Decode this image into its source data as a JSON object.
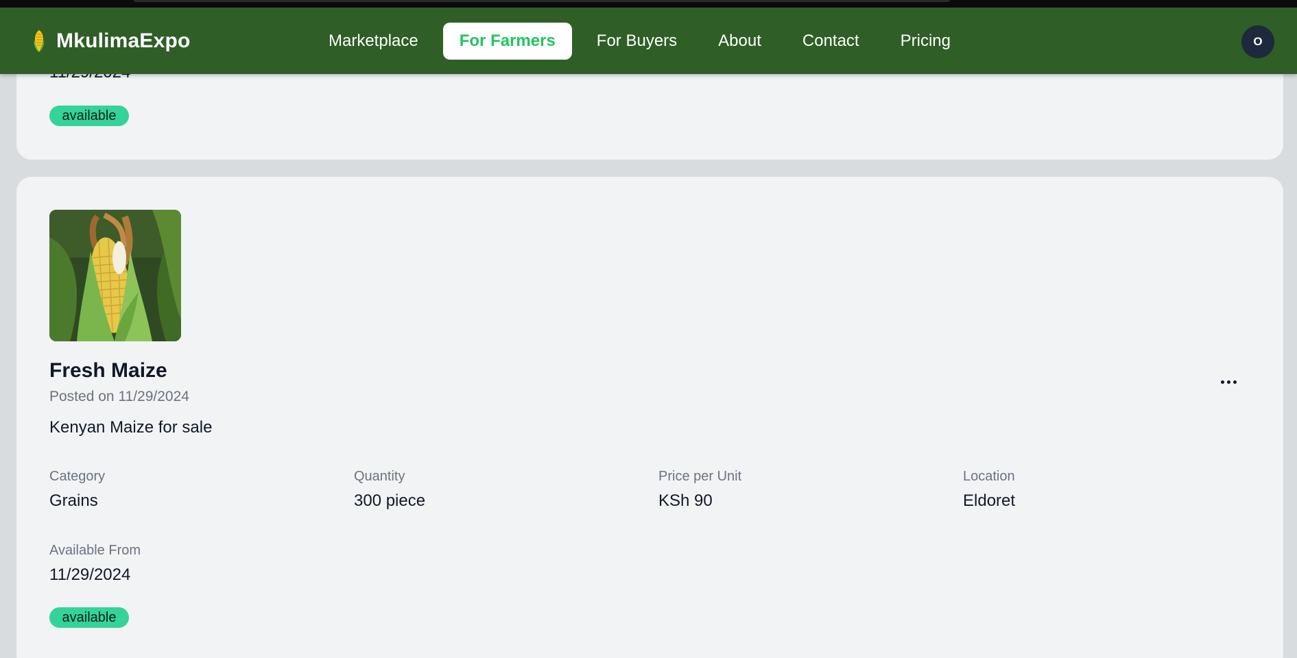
{
  "brand": {
    "name": "MkulimaExpo",
    "icon": "corn-icon"
  },
  "nav": {
    "links": [
      {
        "label": "Marketplace",
        "active": false
      },
      {
        "label": "For Farmers",
        "active": true
      },
      {
        "label": "For Buyers",
        "active": false
      },
      {
        "label": "About",
        "active": false
      },
      {
        "label": "Contact",
        "active": false
      },
      {
        "label": "Pricing",
        "active": false
      }
    ]
  },
  "user": {
    "avatar_initial": "O"
  },
  "previous_listing": {
    "available_from": "11/29/2024",
    "status": "available"
  },
  "listing": {
    "title": "Fresh Maize",
    "posted": "Posted on 11/29/2024",
    "description": "Kenyan Maize for sale",
    "image": "maize-cob-image",
    "menu_icon": "more-horizontal-icon",
    "category_label": "Category",
    "category": "Grains",
    "quantity_label": "Quantity",
    "quantity": "300 piece",
    "price_label": "Price per Unit",
    "price": "KSh 90",
    "location_label": "Location",
    "location": "Eldoret",
    "available_label": "Available From",
    "available_from": "11/29/2024",
    "status": "available"
  },
  "colors": {
    "navbar": "#2f5e27",
    "active_link_text": "#22c55e",
    "badge": "#34d399",
    "card": "#f2f3f5",
    "page": "#d9dcdf",
    "avatar": "#1e293b"
  }
}
